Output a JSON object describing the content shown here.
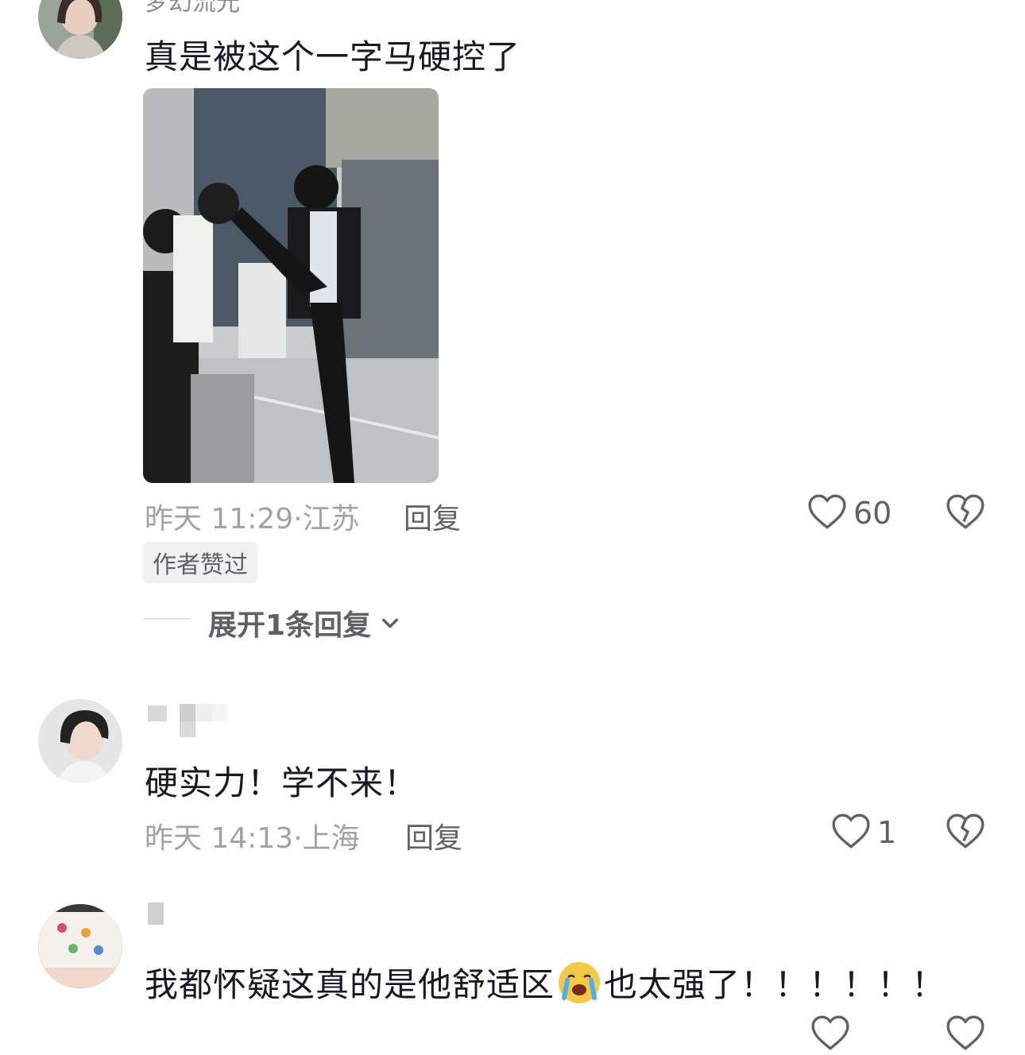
{
  "comments": [
    {
      "username": "梦幻流光",
      "text": "真是被这个一字马硬控了",
      "time": "昨天 11:29",
      "location": "江苏",
      "reply_label": "回复",
      "likes": "60",
      "author_tag": "作者赞过",
      "expand_label": "展开1条回复",
      "avatar_icon": "user-avatar",
      "image_icon": "photo"
    },
    {
      "username": "",
      "text": "硬实力！学不来！",
      "time": "昨天 14:13",
      "location": "上海",
      "reply_label": "回复",
      "likes": "1",
      "avatar_icon": "user-avatar"
    },
    {
      "username": "",
      "text": "我都怀疑这真的是他舒适区",
      "emoji": "😭",
      "text_suffix": "也太强了！！！！！！",
      "avatar_icon": "user-avatar"
    }
  ],
  "separator": "·",
  "colors": {
    "text_primary": "#161823",
    "text_secondary": "#a1a2a7",
    "icon": "#5f6068",
    "tag_bg": "#f1f1f2"
  }
}
